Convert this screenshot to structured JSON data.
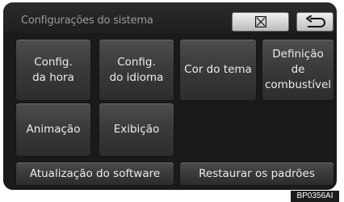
{
  "header": {
    "title": "Configurações do sistema",
    "close_icon": "close-icon",
    "back_icon": "back-arrow-icon"
  },
  "tiles": {
    "time_settings": "Config.\nda hora",
    "language_settings": "Config.\ndo idioma",
    "theme_color": "Cor do tema",
    "fuel_definition": "Definição\nde\ncombustível",
    "animation": "Animação",
    "display": "Exibição",
    "software_update": "Atualização do software",
    "restore_defaults": "Restaurar os padrões"
  },
  "watermark": "BP0356AI",
  "colors": {
    "screen_bg": "#1a1a1a",
    "tile_top": "#4d4d4d",
    "tile_bottom": "#2c2c2c",
    "text": "#ececec",
    "header_button": "#d8d8d8"
  }
}
